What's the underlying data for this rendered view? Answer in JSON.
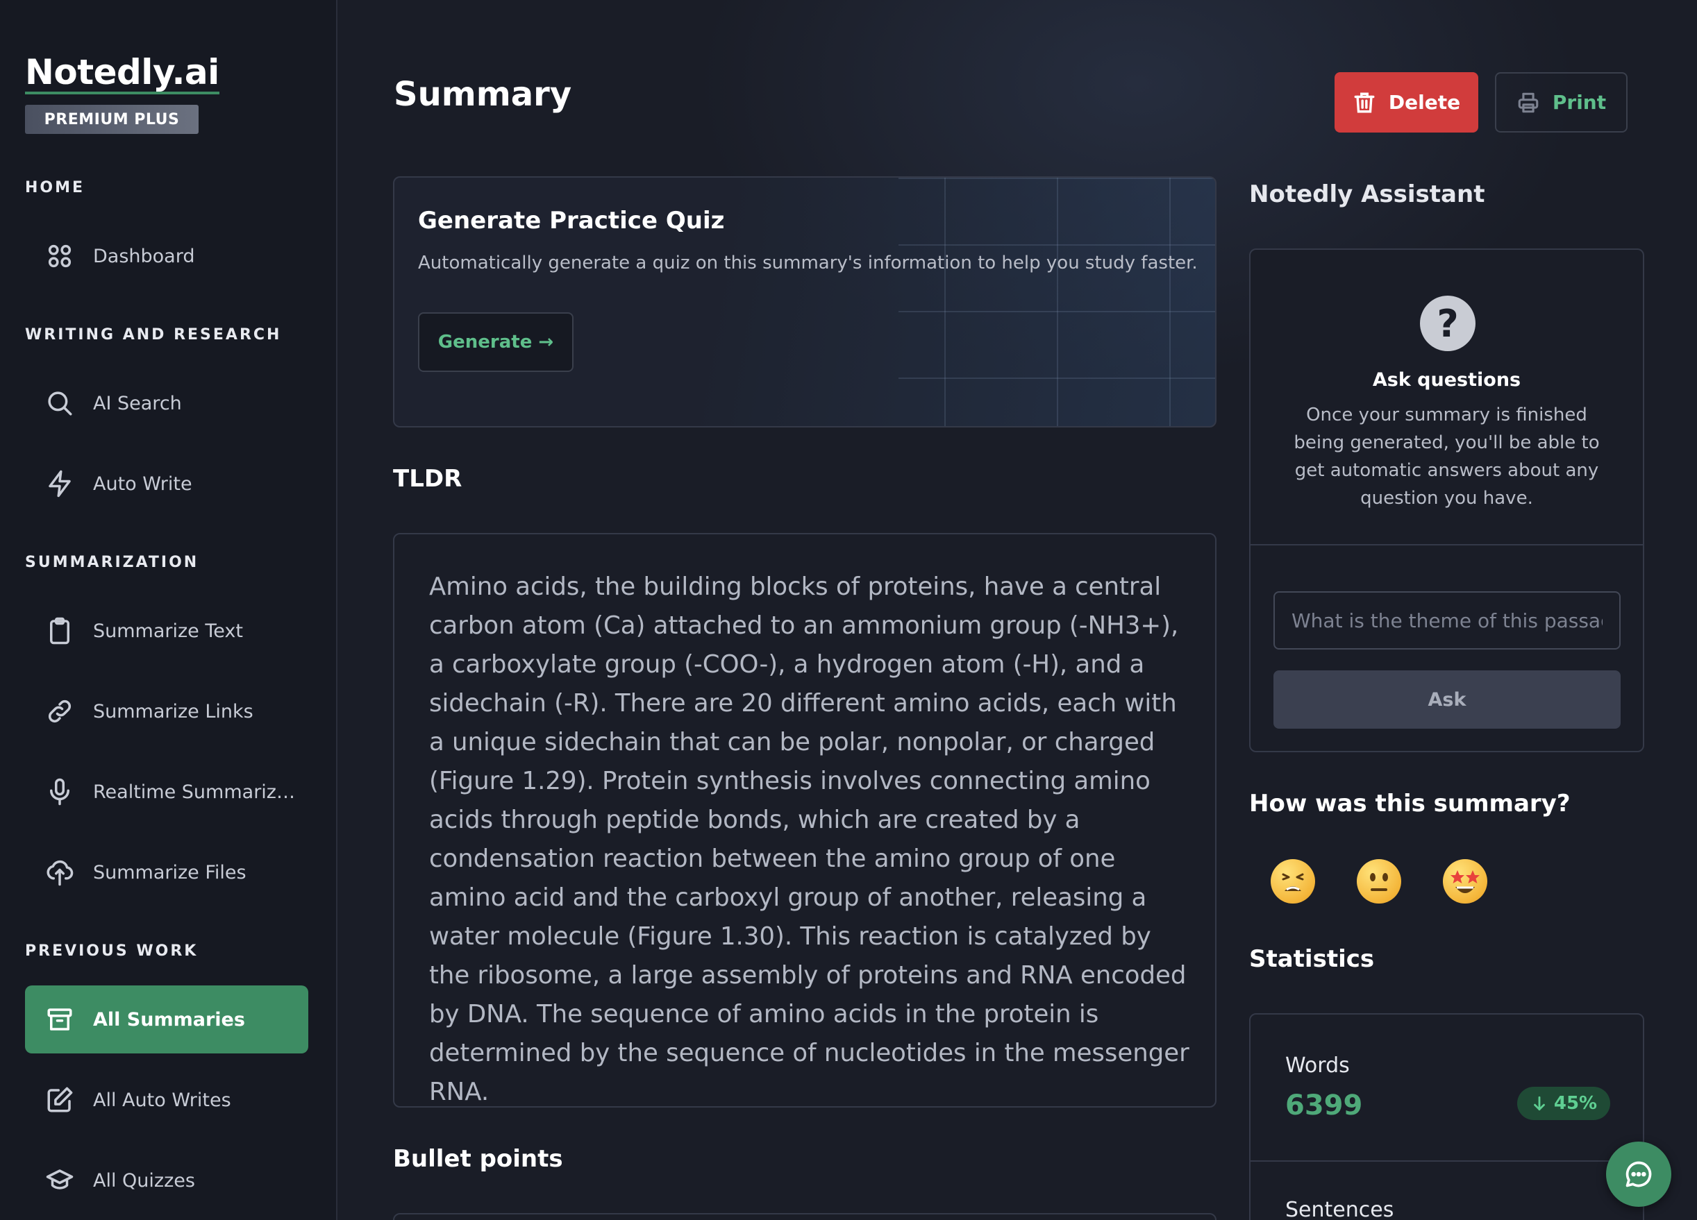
{
  "sidebar": {
    "brand": "Notedly.ai",
    "plan": "PREMIUM PLUS",
    "sections": {
      "home": "HOME",
      "writing": "WRITING AND RESEARCH",
      "summarization": "SUMMARIZATION",
      "previous": "PREVIOUS WORK"
    },
    "items": {
      "dashboard": "Dashboard",
      "ai_search": "AI Search",
      "auto_write": "Auto Write",
      "summarize_text": "Summarize Text",
      "summarize_links": "Summarize Links",
      "realtime": "Realtime Summarizati...",
      "summarize_files": "Summarize Files",
      "all_summaries": "All Summaries",
      "all_auto_writes": "All Auto Writes",
      "all_quizzes": "All Quizzes"
    },
    "active_item": "All Summaries"
  },
  "header": {
    "title": "Summary",
    "delete_label": "Delete",
    "print_label": "Print"
  },
  "quiz": {
    "title": "Generate Practice Quiz",
    "description": "Automatically generate a quiz on this summary's information to help you study faster.",
    "button_label": "Generate →"
  },
  "tldr": {
    "heading": "TLDR",
    "text": "Amino acids, the building blocks of proteins, have a central carbon atom (Ca) attached to an ammonium group (-NH3+), a carboxylate group (-COO-), a hydrogen atom (-H), and a sidechain (-R). There are 20 different amino acids, each with a unique sidechain that can be polar, nonpolar, or charged (Figure 1.29). Protein synthesis involves connecting amino acids through peptide bonds, which are created by a condensation reaction between the amino group of one amino acid and the carboxyl group of another, releasing a water molecule (Figure 1.30). This reaction is catalyzed by the ribosome, a large assembly of proteins and RNA encoded by DNA. The sequence of amino acids in the protein is determined by the sequence of nucleotides in the messenger RNA."
  },
  "bullets": {
    "heading": "Bullet points"
  },
  "assistant": {
    "heading": "Notedly Assistant",
    "ask_title": "Ask questions",
    "ask_description": "Once your summary is finished being generated, you'll be able to get automatic answers about any question you have.",
    "input_placeholder": "What is the theme of this passage?",
    "input_value": "",
    "ask_label": "Ask"
  },
  "feedback": {
    "heading": "How was this summary?",
    "options": [
      "tired-face",
      "neutral-face",
      "star-struck-face"
    ]
  },
  "statistics": {
    "heading": "Statistics",
    "words_label": "Words",
    "words_value": "6399",
    "words_change": "45%",
    "words_change_direction": "down",
    "sentences_label": "Sentences"
  },
  "colors": {
    "accent": "#3d8c63",
    "danger": "#d13c3c",
    "background": "#1a1d27",
    "sidebar": "#161922"
  }
}
